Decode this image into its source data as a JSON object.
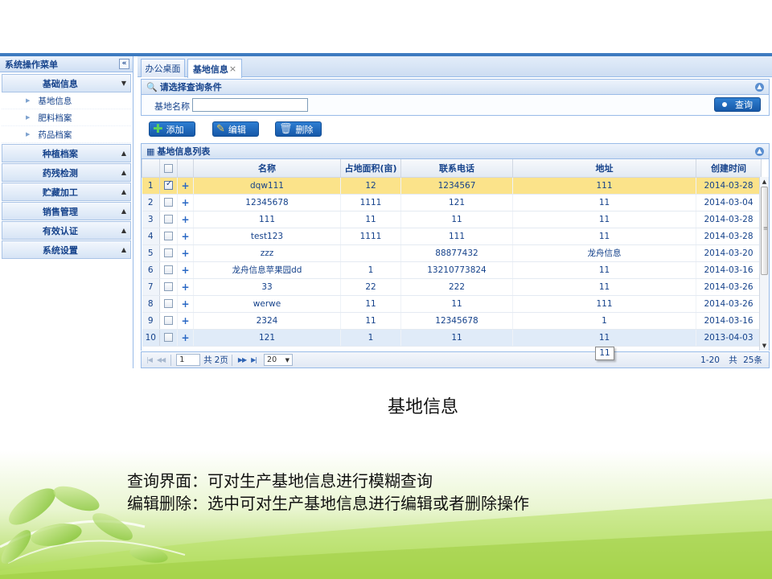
{
  "sidebar": {
    "title": "系统操作菜单",
    "collapse_icon": "«",
    "sections": [
      {
        "label": "基础信息",
        "expanded": true,
        "items": [
          "基地信息",
          "肥料档案",
          "药品档案"
        ]
      },
      {
        "label": "种植档案",
        "expanded": false
      },
      {
        "label": "药残检测",
        "expanded": false
      },
      {
        "label": "贮藏加工",
        "expanded": false
      },
      {
        "label": "销售管理",
        "expanded": false
      },
      {
        "label": "有效认证",
        "expanded": false
      },
      {
        "label": "系统设置",
        "expanded": false
      }
    ]
  },
  "tabs": [
    {
      "label": "办公桌面",
      "active": false
    },
    {
      "label": "基地信息",
      "active": true,
      "close": "×"
    }
  ],
  "query": {
    "title": "请选择查询条件",
    "field_label": "基地名称",
    "field_value": "",
    "button": "查询"
  },
  "toolbar": {
    "add": "添加",
    "edit": "编辑",
    "delete": "删除"
  },
  "grid": {
    "title": "基地信息列表",
    "columns": [
      "名称",
      "占地面积(亩)",
      "联系电话",
      "地址",
      "创建时间"
    ],
    "rows": [
      {
        "n": "1",
        "name": "dqw111",
        "area": "12",
        "phone": "1234567",
        "addr": "111",
        "date": "2014-03-28"
      },
      {
        "n": "2",
        "name": "12345678",
        "area": "1111",
        "phone": "121",
        "addr": "11",
        "date": "2014-03-04"
      },
      {
        "n": "3",
        "name": "111",
        "area": "11",
        "phone": "11",
        "addr": "11",
        "date": "2014-03-28"
      },
      {
        "n": "4",
        "name": "test123",
        "area": "1111",
        "phone": "111",
        "addr": "11",
        "date": "2014-03-28"
      },
      {
        "n": "5",
        "name": "zzz",
        "area": "",
        "phone": "88877432",
        "addr": "龙舟信息",
        "date": "2014-03-20"
      },
      {
        "n": "6",
        "name": "龙舟信息苹果园dd",
        "area": "1",
        "phone": "13210773824",
        "addr": "11",
        "date": "2014-03-16"
      },
      {
        "n": "7",
        "name": "33",
        "area": "22",
        "phone": "222",
        "addr": "11",
        "date": "2014-03-26"
      },
      {
        "n": "8",
        "name": "werwe",
        "area": "11",
        "phone": "11",
        "addr": "111",
        "date": "2014-03-26"
      },
      {
        "n": "9",
        "name": "2324",
        "area": "11",
        "phone": "12345678",
        "addr": "1",
        "date": "2014-03-16"
      },
      {
        "n": "10",
        "name": "121",
        "area": "1",
        "phone": "11",
        "addr": "11",
        "date": "2013-04-03"
      }
    ],
    "selected_row": 1,
    "expand_glyph": "+",
    "tooltip": "11"
  },
  "pager": {
    "first": "|◀",
    "prev": "◀◀",
    "page_value": "1",
    "of_prefix": "共",
    "total_pages": "2页",
    "next": "▶▶",
    "last": "▶|",
    "page_size": "20",
    "summary_range": "1-20",
    "summary_total_prefix": "共",
    "summary_total": "25条"
  },
  "caption": {
    "title": "基地信息",
    "line1": "查询界面：可对生产基地信息进行模糊查询",
    "line2": "编辑删除：选中可对生产基地信息进行编辑或者删除操作"
  },
  "colors": {
    "accent_blue": "#3e7bc0",
    "header_text": "#15428b",
    "selected_row": "#fbe38a",
    "button_blue": "#1f6bbf"
  }
}
